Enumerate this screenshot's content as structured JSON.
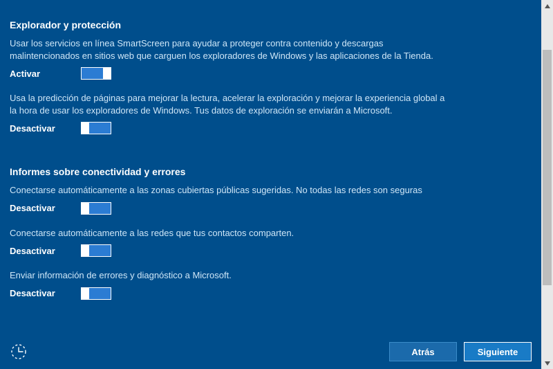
{
  "sections": {
    "browser": {
      "heading": "Explorador y protección",
      "items": [
        {
          "desc": "Usar los servicios en línea SmartScreen para ayudar a proteger contra contenido y descargas malintencionados en sitios web que carguen los exploradores de Windows y las aplicaciones de la Tienda.",
          "state_label": "Activar",
          "on": true
        },
        {
          "desc": "Usa la predicción de páginas para mejorar la lectura, acelerar la exploración y mejorar la experiencia global a la hora de usar los exploradores de Windows. Tus datos de exploración se enviarán a Microsoft.",
          "state_label": "Desactivar",
          "on": false
        }
      ]
    },
    "connectivity": {
      "heading": "Informes sobre conectividad y errores",
      "items": [
        {
          "desc": "Conectarse automáticamente a las zonas cubiertas públicas sugeridas. No todas las redes son seguras",
          "state_label": "Desactivar",
          "on": false
        },
        {
          "desc": "Conectarse automáticamente a las redes que tus contactos comparten.",
          "state_label": "Desactivar",
          "on": false
        },
        {
          "desc": "Enviar información de errores y diagnóstico a Microsoft.",
          "state_label": "Desactivar",
          "on": false
        }
      ]
    }
  },
  "footer": {
    "back_label": "Atrás",
    "next_label": "Siguiente"
  }
}
